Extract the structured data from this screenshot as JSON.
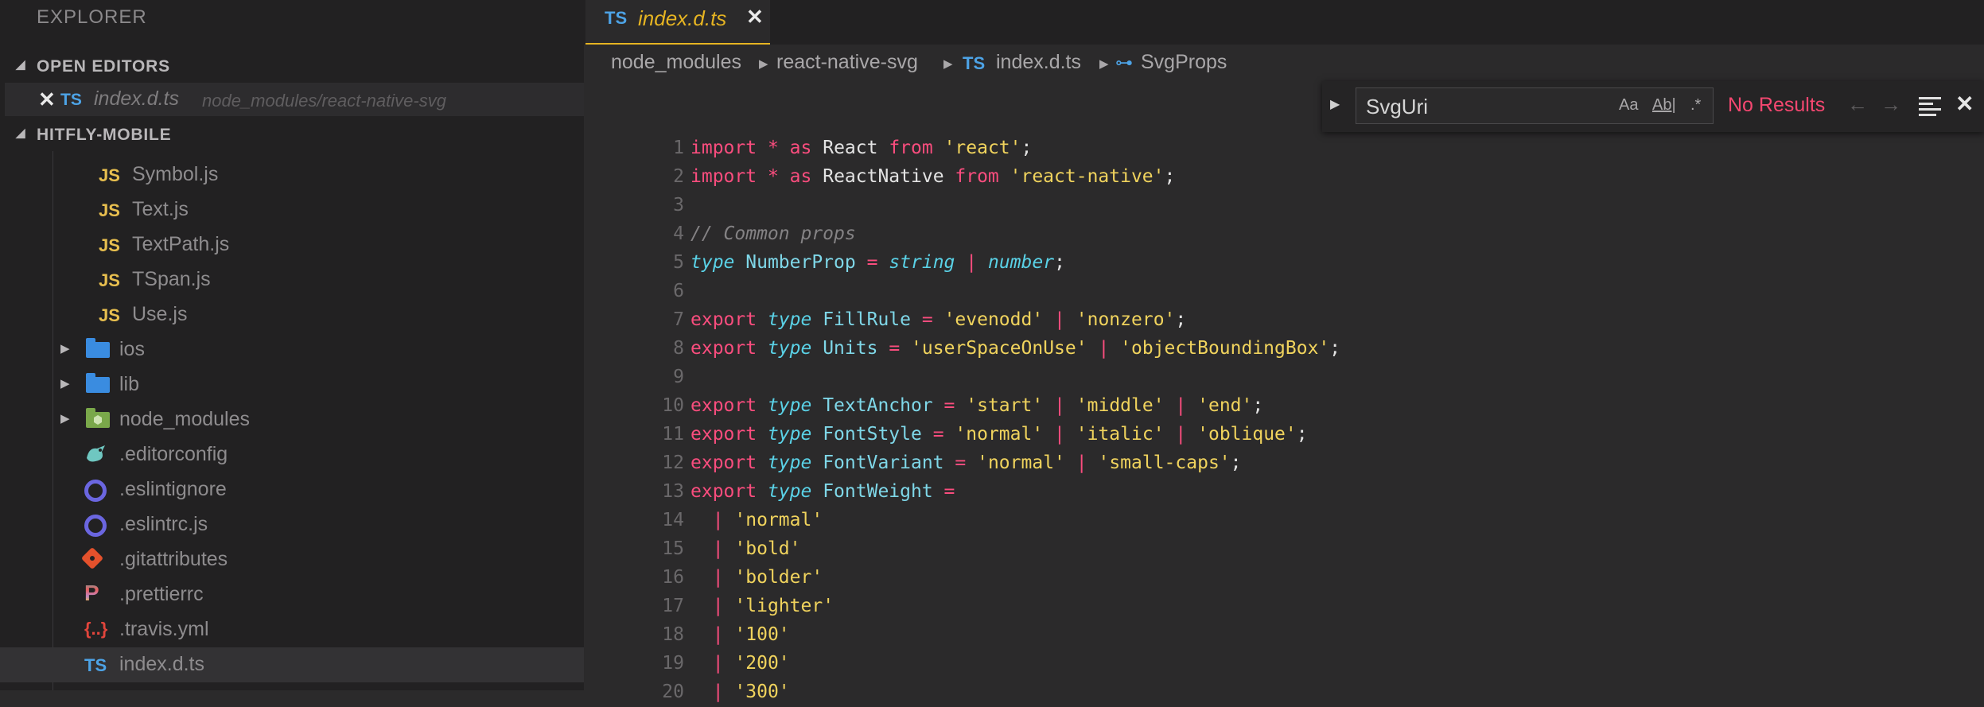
{
  "sidebar": {
    "title": "EXPLORER",
    "open_editors": {
      "label": "OPEN EDITORS",
      "item": {
        "lang": "TS",
        "name": "index.d.ts",
        "path": "node_modules/react-native-svg"
      }
    },
    "project": {
      "label": "HITFLY-MOBILE"
    },
    "tree": [
      {
        "icon": "JS",
        "label": "Symbol.js"
      },
      {
        "icon": "JS",
        "label": "Text.js"
      },
      {
        "icon": "JS",
        "label": "TextPath.js"
      },
      {
        "icon": "JS",
        "label": "TSpan.js"
      },
      {
        "icon": "JS",
        "label": "Use.js"
      },
      {
        "icon": "folder",
        "label": "ios"
      },
      {
        "icon": "folder",
        "label": "lib"
      },
      {
        "icon": "node-folder",
        "label": "node_modules"
      },
      {
        "icon": "editorconfig",
        "label": ".editorconfig"
      },
      {
        "icon": "eslint",
        "label": ".eslintignore"
      },
      {
        "icon": "eslint",
        "label": ".eslintrc.js"
      },
      {
        "icon": "git",
        "label": ".gitattributes"
      },
      {
        "icon": "prettier",
        "label": ".prettierrc"
      },
      {
        "icon": "{..}",
        "label": ".travis.yml"
      },
      {
        "icon": "TS",
        "label": "index.d.ts"
      }
    ]
  },
  "tab": {
    "lang": "TS",
    "name": "index.d.ts",
    "close_glyph": "✕"
  },
  "breadcrumbs": {
    "parts": [
      "node_modules",
      "react-native-svg",
      "index.d.ts",
      "SvgProps"
    ],
    "ts_badge": "TS"
  },
  "find": {
    "value": "SvgUri",
    "match_case": "Aa",
    "whole_word": "Ab|",
    "regex": ".*",
    "status": "No Results",
    "status_color": "#f44770"
  },
  "editor": {
    "line_numbers": [
      "1",
      "2",
      "3",
      "4",
      "5",
      "6",
      "7",
      "8",
      "9",
      "10",
      "11",
      "12",
      "13",
      "14",
      "15",
      "16",
      "17",
      "18",
      "19",
      "20"
    ],
    "lines": [
      [
        [
          "kw",
          "import"
        ],
        [
          "id",
          " "
        ],
        [
          "op",
          "*"
        ],
        [
          "id",
          " "
        ],
        [
          "kw",
          "as"
        ],
        [
          "id",
          " React "
        ],
        [
          "kw",
          "from"
        ],
        [
          "id",
          " "
        ],
        [
          "str",
          "'react'"
        ],
        [
          "punc",
          ";"
        ]
      ],
      [
        [
          "kw",
          "import"
        ],
        [
          "id",
          " "
        ],
        [
          "op",
          "*"
        ],
        [
          "id",
          " "
        ],
        [
          "kw",
          "as"
        ],
        [
          "id",
          " ReactNative "
        ],
        [
          "kw",
          "from"
        ],
        [
          "id",
          " "
        ],
        [
          "str",
          "'react-native'"
        ],
        [
          "punc",
          ";"
        ]
      ],
      [],
      [
        [
          "cm",
          "// Common props"
        ]
      ],
      [
        [
          "ty",
          "type"
        ],
        [
          "id",
          " "
        ],
        [
          "tn",
          "NumberProp"
        ],
        [
          "id",
          " "
        ],
        [
          "op",
          "="
        ],
        [
          "id",
          " "
        ],
        [
          "ty",
          "string"
        ],
        [
          "id",
          " "
        ],
        [
          "op",
          "|"
        ],
        [
          "id",
          " "
        ],
        [
          "ty",
          "number"
        ],
        [
          "punc",
          ";"
        ]
      ],
      [],
      [
        [
          "kw",
          "export"
        ],
        [
          "id",
          " "
        ],
        [
          "ty",
          "type"
        ],
        [
          "id",
          " "
        ],
        [
          "tn",
          "FillRule"
        ],
        [
          "id",
          " "
        ],
        [
          "op",
          "="
        ],
        [
          "id",
          " "
        ],
        [
          "str",
          "'evenodd'"
        ],
        [
          "id",
          " "
        ],
        [
          "op",
          "|"
        ],
        [
          "id",
          " "
        ],
        [
          "str",
          "'nonzero'"
        ],
        [
          "punc",
          ";"
        ]
      ],
      [
        [
          "kw",
          "export"
        ],
        [
          "id",
          " "
        ],
        [
          "ty",
          "type"
        ],
        [
          "id",
          " "
        ],
        [
          "tn",
          "Units"
        ],
        [
          "id",
          " "
        ],
        [
          "op",
          "="
        ],
        [
          "id",
          " "
        ],
        [
          "str",
          "'userSpaceOnUse'"
        ],
        [
          "id",
          " "
        ],
        [
          "op",
          "|"
        ],
        [
          "id",
          " "
        ],
        [
          "str",
          "'objectBoundingBox'"
        ],
        [
          "punc",
          ";"
        ]
      ],
      [],
      [
        [
          "kw",
          "export"
        ],
        [
          "id",
          " "
        ],
        [
          "ty",
          "type"
        ],
        [
          "id",
          " "
        ],
        [
          "tn",
          "TextAnchor"
        ],
        [
          "id",
          " "
        ],
        [
          "op",
          "="
        ],
        [
          "id",
          " "
        ],
        [
          "str",
          "'start'"
        ],
        [
          "id",
          " "
        ],
        [
          "op",
          "|"
        ],
        [
          "id",
          " "
        ],
        [
          "str",
          "'middle'"
        ],
        [
          "id",
          " "
        ],
        [
          "op",
          "|"
        ],
        [
          "id",
          " "
        ],
        [
          "str",
          "'end'"
        ],
        [
          "punc",
          ";"
        ]
      ],
      [
        [
          "kw",
          "export"
        ],
        [
          "id",
          " "
        ],
        [
          "ty",
          "type"
        ],
        [
          "id",
          " "
        ],
        [
          "tn",
          "FontStyle"
        ],
        [
          "id",
          " "
        ],
        [
          "op",
          "="
        ],
        [
          "id",
          " "
        ],
        [
          "str",
          "'normal'"
        ],
        [
          "id",
          " "
        ],
        [
          "op",
          "|"
        ],
        [
          "id",
          " "
        ],
        [
          "str",
          "'italic'"
        ],
        [
          "id",
          " "
        ],
        [
          "op",
          "|"
        ],
        [
          "id",
          " "
        ],
        [
          "str",
          "'oblique'"
        ],
        [
          "punc",
          ";"
        ]
      ],
      [
        [
          "kw",
          "export"
        ],
        [
          "id",
          " "
        ],
        [
          "ty",
          "type"
        ],
        [
          "id",
          " "
        ],
        [
          "tn",
          "FontVariant"
        ],
        [
          "id",
          " "
        ],
        [
          "op",
          "="
        ],
        [
          "id",
          " "
        ],
        [
          "str",
          "'normal'"
        ],
        [
          "id",
          " "
        ],
        [
          "op",
          "|"
        ],
        [
          "id",
          " "
        ],
        [
          "str",
          "'small-caps'"
        ],
        [
          "punc",
          ";"
        ]
      ],
      [
        [
          "kw",
          "export"
        ],
        [
          "id",
          " "
        ],
        [
          "ty",
          "type"
        ],
        [
          "id",
          " "
        ],
        [
          "tn",
          "FontWeight"
        ],
        [
          "id",
          " "
        ],
        [
          "op",
          "="
        ]
      ],
      [
        [
          "id",
          "  "
        ],
        [
          "op",
          "|"
        ],
        [
          "id",
          " "
        ],
        [
          "str",
          "'normal'"
        ]
      ],
      [
        [
          "id",
          "  "
        ],
        [
          "op",
          "|"
        ],
        [
          "id",
          " "
        ],
        [
          "str",
          "'bold'"
        ]
      ],
      [
        [
          "id",
          "  "
        ],
        [
          "op",
          "|"
        ],
        [
          "id",
          " "
        ],
        [
          "str",
          "'bolder'"
        ]
      ],
      [
        [
          "id",
          "  "
        ],
        [
          "op",
          "|"
        ],
        [
          "id",
          " "
        ],
        [
          "str",
          "'lighter'"
        ]
      ],
      [
        [
          "id",
          "  "
        ],
        [
          "op",
          "|"
        ],
        [
          "id",
          " "
        ],
        [
          "str",
          "'100'"
        ]
      ],
      [
        [
          "id",
          "  "
        ],
        [
          "op",
          "|"
        ],
        [
          "id",
          " "
        ],
        [
          "str",
          "'200'"
        ]
      ],
      [
        [
          "id",
          "  "
        ],
        [
          "op",
          "|"
        ],
        [
          "id",
          " "
        ],
        [
          "str",
          "'300'"
        ]
      ]
    ]
  },
  "colors": {
    "keyword": "#fa4d7e",
    "type": "#5ad1e6",
    "string": "#f0d35d",
    "comment": "#848284",
    "tab_accent": "#e6b422",
    "ts_badge": "#4da3e6",
    "js_badge": "#e8bf4f"
  }
}
